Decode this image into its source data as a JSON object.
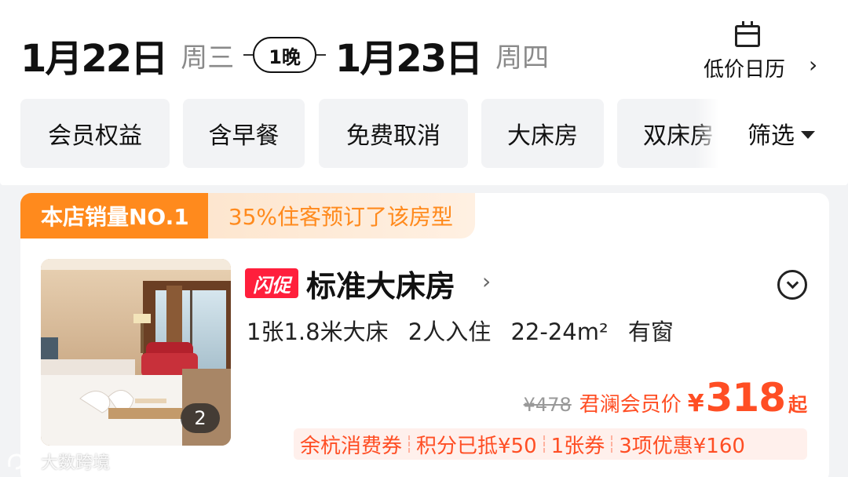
{
  "dates": {
    "checkin_date": "1月22日",
    "checkin_weekday": "周三",
    "nights": "1晚",
    "checkout_date": "1月23日",
    "checkout_weekday": "周四"
  },
  "calendar": {
    "label": "低价日历"
  },
  "filters": {
    "chips": [
      "会员权益",
      "含早餐",
      "免费取消",
      "大床房",
      "双床房"
    ],
    "screen_label": "筛选"
  },
  "room_card": {
    "rank_label": "本店销量NO.1",
    "rank_desc": "35%住客预订了该房型",
    "image_count": "2",
    "flash_badge": "闪促",
    "room_name": "标准大床房",
    "details": [
      "1张1.8米大床",
      "2人入住",
      "22-24m²",
      "有窗"
    ],
    "original_price": "¥478",
    "member_price_label": "君澜会员价",
    "currency": "¥",
    "price": "318",
    "price_suffix": "起",
    "promos": [
      "余杭消费券",
      "积分已抵¥50",
      "1张券",
      "3项优惠¥160"
    ]
  },
  "watermark": {
    "text": "大数跨境"
  },
  "colors": {
    "accent": "#ff4e24",
    "rank_orange": "#ff8a1d",
    "flash_red": "#ff1f3c"
  }
}
